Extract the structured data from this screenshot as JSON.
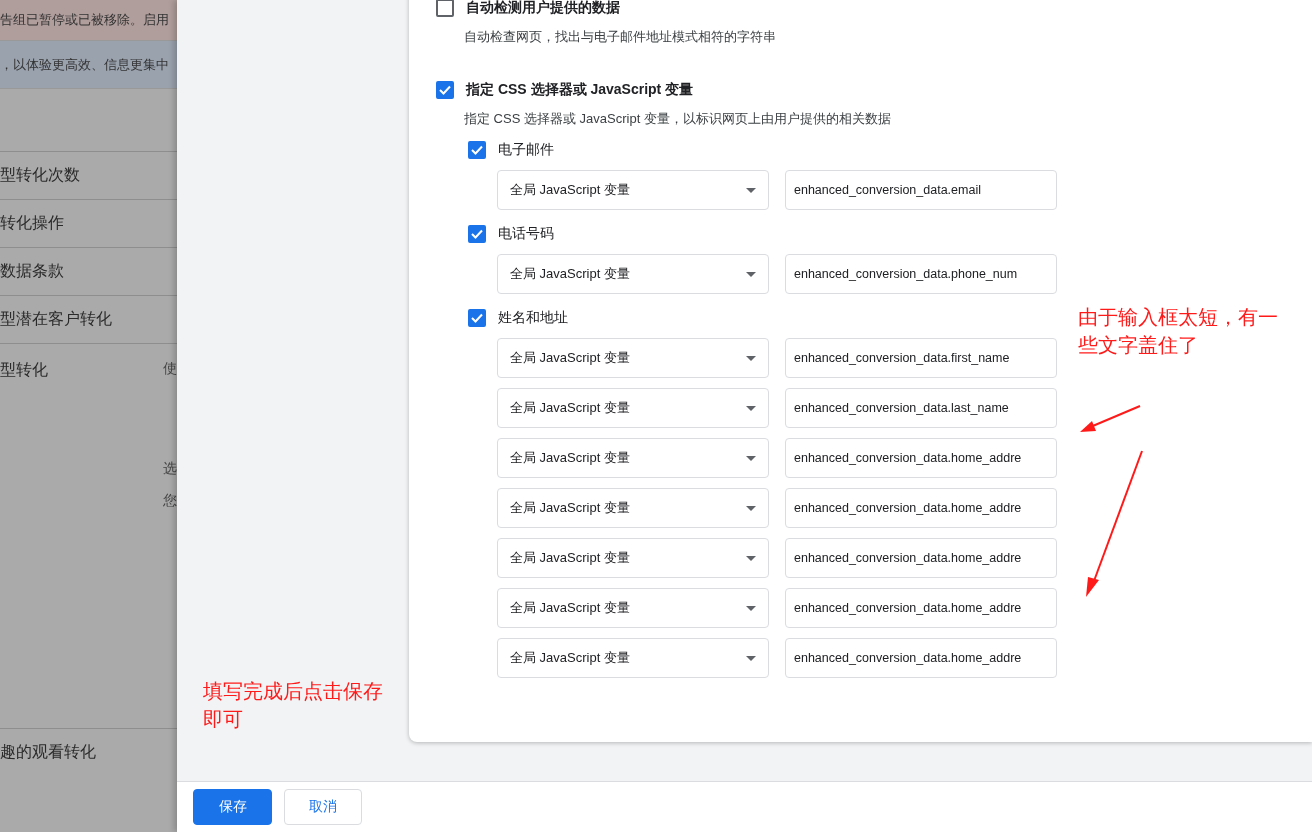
{
  "background": {
    "banners": [
      {
        "kind": "warning",
        "text": "告组已暂停或已被移除。启用"
      },
      {
        "kind": "info",
        "text": "，以体验更高效、信息更集中"
      }
    ],
    "rows": [
      {
        "label": "型转化次数"
      },
      {
        "label": "转化操作"
      },
      {
        "label": "数据条款"
      },
      {
        "label": "型潜在客户转化"
      }
    ],
    "section": {
      "label": "型转化",
      "side_texts": [
        "使",
        "选",
        "您"
      ]
    },
    "bottom_rows": [
      {
        "label": "趣的观看转化"
      }
    ]
  },
  "options": [
    {
      "label": "自动检测用户提供的数据",
      "checked": false,
      "description": "自动检查网页，找出与电子邮件地址模式相符的字符串"
    },
    {
      "label": "指定 CSS 选择器或 JavaScript 变量",
      "checked": true,
      "description": "指定 CSS 选择器或 JavaScript 变量，以标识网页上由用户提供的相关数据"
    }
  ],
  "groups": [
    {
      "label": "电子邮件",
      "checked": true,
      "fields": [
        {
          "type": "全局 JavaScript 变量",
          "value": "enhanced_conversion_data.email"
        }
      ]
    },
    {
      "label": "电话号码",
      "checked": true,
      "fields": [
        {
          "type": "全局 JavaScript 变量",
          "value": "enhanced_conversion_data.phone_num"
        }
      ]
    },
    {
      "label": "姓名和地址",
      "checked": true,
      "fields": [
        {
          "type": "全局 JavaScript 变量",
          "value": "enhanced_conversion_data.first_name"
        },
        {
          "type": "全局 JavaScript 变量",
          "value": "enhanced_conversion_data.last_name"
        },
        {
          "type": "全局 JavaScript 变量",
          "value": "enhanced_conversion_data.home_addre"
        },
        {
          "type": "全局 JavaScript 变量",
          "value": "enhanced_conversion_data.home_addre"
        },
        {
          "type": "全局 JavaScript 变量",
          "value": "enhanced_conversion_data.home_addre"
        },
        {
          "type": "全局 JavaScript 变量",
          "value": "enhanced_conversion_data.home_addre"
        },
        {
          "type": "全局 JavaScript 变量",
          "value": "enhanced_conversion_data.home_addre"
        }
      ]
    }
  ],
  "annotations": [
    {
      "kind": "fields",
      "text": "由于输入框太短，有一些文字盖住了"
    },
    {
      "kind": "save",
      "text": "填写完成后点击保存即可"
    }
  ],
  "footer": {
    "buttons": [
      {
        "label": "保存",
        "kind": "primary"
      },
      {
        "label": "取消",
        "kind": "secondary"
      }
    ]
  }
}
